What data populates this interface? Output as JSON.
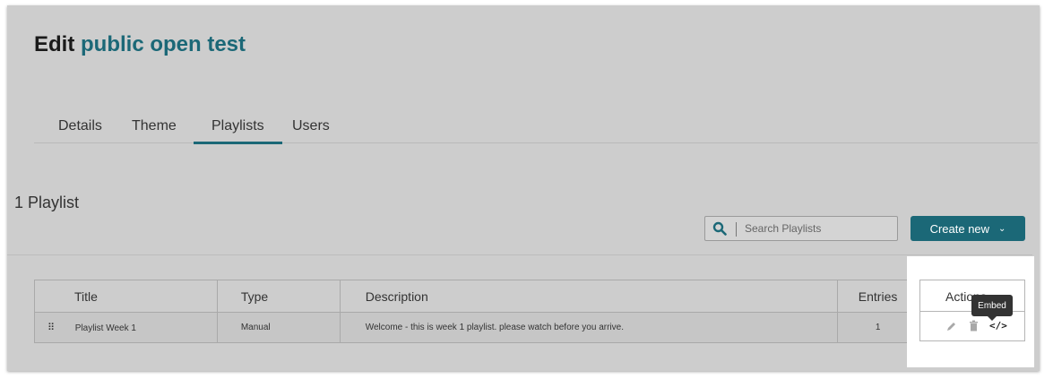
{
  "header": {
    "prefix": "Edit",
    "name": "public open test"
  },
  "tabs": [
    {
      "label": "Details"
    },
    {
      "label": "Theme"
    },
    {
      "label": "Playlists",
      "active": true
    },
    {
      "label": "Users"
    }
  ],
  "summary": {
    "count_label": "1 Playlist"
  },
  "search": {
    "placeholder": "Search Playlists",
    "icon": "search-icon"
  },
  "create_button": {
    "label": "Create new",
    "icon": "chevron-down-icon"
  },
  "table": {
    "headers": [
      "Title",
      "Type",
      "Description",
      "Entries",
      "Actions"
    ],
    "rows": [
      {
        "handle": "⠿",
        "title": "Playlist Week 1",
        "type": "Manual",
        "description": "Welcome - this is week 1 playlist. please watch before you arrive.",
        "entries": "1",
        "actions": [
          "edit-icon",
          "trash-icon",
          "embed-icon"
        ]
      }
    ]
  },
  "tooltip": {
    "text": "Embed"
  },
  "colors": {
    "accent": "#1b6877",
    "background": "#cdcdcd"
  }
}
